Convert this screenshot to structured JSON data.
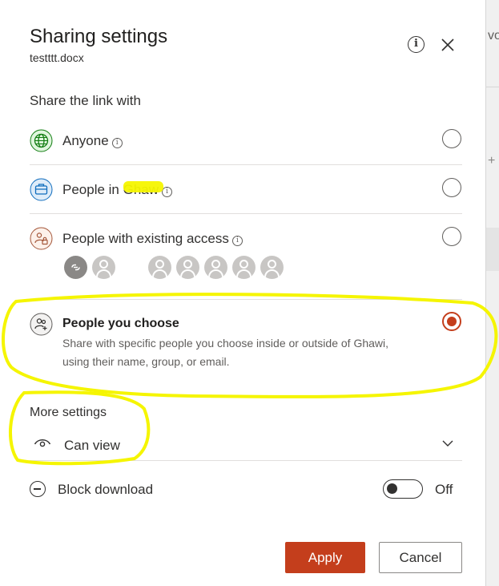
{
  "dialog": {
    "title": "Sharing settings",
    "filename": "testttt.docx",
    "info_glyph": "i",
    "close_icon": "close-icon"
  },
  "share": {
    "section_label": "Share the link with",
    "options": [
      {
        "label": "Anyone",
        "icon": "globe-icon",
        "info": true,
        "selected": false
      },
      {
        "label": "People in Ghaw",
        "icon": "briefcase-icon",
        "info": true,
        "selected": false
      },
      {
        "label": "People with existing access",
        "icon": "people-lock-icon",
        "info": true,
        "selected": false
      },
      {
        "label": "People you choose",
        "icon": "people-add-icon",
        "selected": true,
        "description": "Share with specific people you choose inside or outside of Ghawi, using their name, group, or email."
      }
    ],
    "info_glyph": "i"
  },
  "more_settings": {
    "label": "More settings",
    "permission": "Can view",
    "block_download_label": "Block download",
    "block_download_state": "Off"
  },
  "buttons": {
    "apply": "Apply",
    "cancel": "Cancel"
  },
  "background": {
    "partial_text": "vo",
    "plus": "+"
  },
  "colors": {
    "accent": "#c43e1c",
    "highlighter": "#f5f500",
    "text": "#323130",
    "avatar_grey": "#c8c6c4"
  }
}
